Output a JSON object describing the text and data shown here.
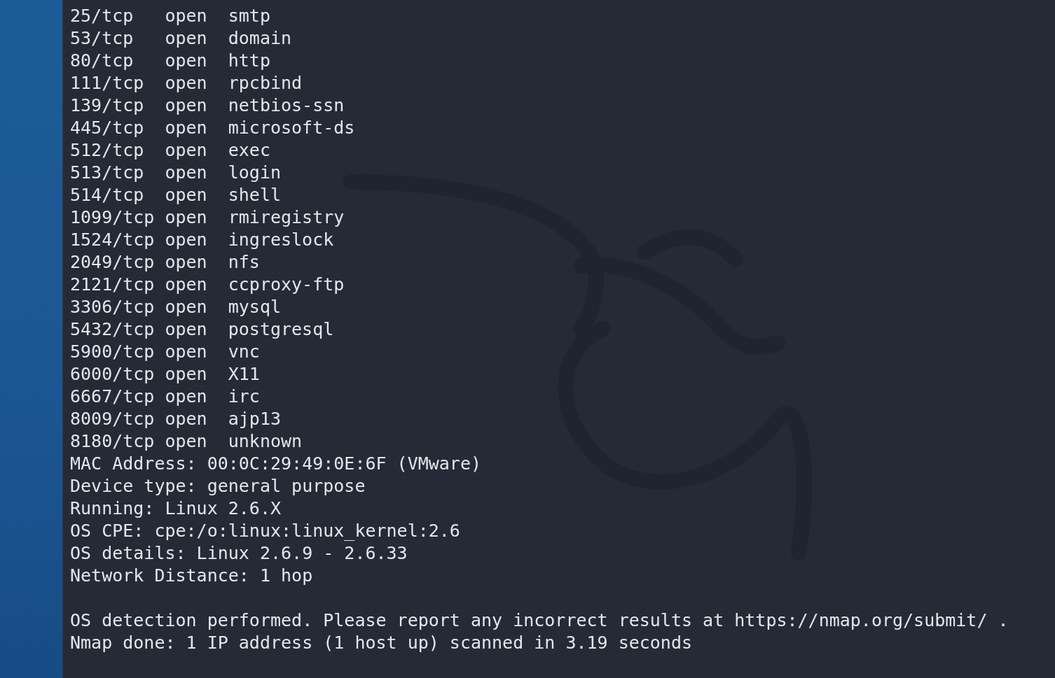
{
  "ports": [
    {
      "port": "25/tcp",
      "state": "open",
      "service": "smtp"
    },
    {
      "port": "53/tcp",
      "state": "open",
      "service": "domain"
    },
    {
      "port": "80/tcp",
      "state": "open",
      "service": "http"
    },
    {
      "port": "111/tcp",
      "state": "open",
      "service": "rpcbind"
    },
    {
      "port": "139/tcp",
      "state": "open",
      "service": "netbios-ssn"
    },
    {
      "port": "445/tcp",
      "state": "open",
      "service": "microsoft-ds"
    },
    {
      "port": "512/tcp",
      "state": "open",
      "service": "exec"
    },
    {
      "port": "513/tcp",
      "state": "open",
      "service": "login"
    },
    {
      "port": "514/tcp",
      "state": "open",
      "service": "shell"
    },
    {
      "port": "1099/tcp",
      "state": "open",
      "service": "rmiregistry"
    },
    {
      "port": "1524/tcp",
      "state": "open",
      "service": "ingreslock"
    },
    {
      "port": "2049/tcp",
      "state": "open",
      "service": "nfs"
    },
    {
      "port": "2121/tcp",
      "state": "open",
      "service": "ccproxy-ftp"
    },
    {
      "port": "3306/tcp",
      "state": "open",
      "service": "mysql"
    },
    {
      "port": "5432/tcp",
      "state": "open",
      "service": "postgresql"
    },
    {
      "port": "5900/tcp",
      "state": "open",
      "service": "vnc"
    },
    {
      "port": "6000/tcp",
      "state": "open",
      "service": "X11"
    },
    {
      "port": "6667/tcp",
      "state": "open",
      "service": "irc"
    },
    {
      "port": "8009/tcp",
      "state": "open",
      "service": "ajp13"
    },
    {
      "port": "8180/tcp",
      "state": "open",
      "service": "unknown"
    }
  ],
  "details": [
    "MAC Address: 00:0C:29:49:0E:6F (VMware)",
    "Device type: general purpose",
    "Running: Linux 2.6.X",
    "OS CPE: cpe:/o:linux:linux_kernel:2.6",
    "OS details: Linux 2.6.9 - 2.6.33",
    "Network Distance: 1 hop"
  ],
  "footer": [
    "OS detection performed. Please report any incorrect results at https://nmap.org/submit/ .",
    "Nmap done: 1 IP address (1 host up) scanned in 3.19 seconds"
  ]
}
